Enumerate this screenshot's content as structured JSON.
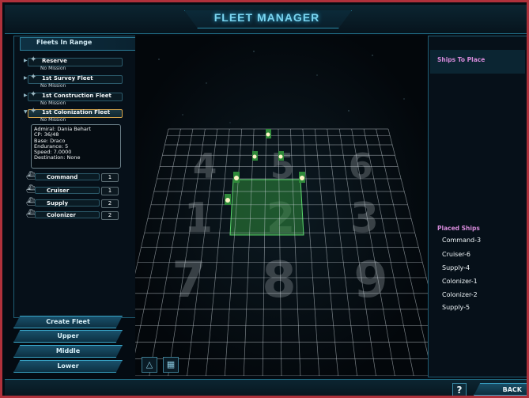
{
  "title": "FLEET MANAGER",
  "left": {
    "header": "Fleets In Range",
    "fleets": [
      {
        "name": "Reserve",
        "mission": "No Mission",
        "selected": false
      },
      {
        "name": "1st Survey Fleet",
        "mission": "No Mission",
        "selected": false
      },
      {
        "name": "1st Construction Fleet",
        "mission": "No Mission",
        "selected": false
      },
      {
        "name": "1st Colonization Fleet",
        "mission": "No Mission",
        "selected": true
      }
    ],
    "info": {
      "admiral": "Admiral: Dania Behart",
      "cp": "CP: 36/48",
      "base": "Base: Draco",
      "endurance": "Endurance: 5",
      "speed": "Speed: 7.0000",
      "destination": "Destination: None"
    },
    "ships": [
      {
        "name": "Command",
        "count": "1"
      },
      {
        "name": "Cruiser",
        "count": "1"
      },
      {
        "name": "Supply",
        "count": "2"
      },
      {
        "name": "Colonizer",
        "count": "2"
      }
    ],
    "buttons": [
      "Create Fleet",
      "Upper",
      "Middle",
      "Lower"
    ]
  },
  "grid": {
    "cell_numbers": [
      "4",
      "5",
      "6",
      "1",
      "2",
      "3",
      "7",
      "8",
      "9"
    ]
  },
  "right": {
    "ships_to_place_label": "Ships To Place",
    "placed_label": "Placed Ships",
    "placed": [
      "Command-3",
      "Cruiser-6",
      "Supply-4",
      "Colonizer-1",
      "Colonizer-2",
      "Supply-5"
    ]
  },
  "bottom": {
    "help": "?",
    "back": "BACK"
  },
  "colors": {
    "accent": "#3aa6c8",
    "highlight_cells": "#2f8a3a",
    "placed_label": "#d58ad9",
    "frame": "#b0313b"
  },
  "icons": {
    "formation": "triangle-formation-icon",
    "grid": "grid-view-icon",
    "fleet": "fleet-insignia-icon",
    "ship": "ship-icon"
  }
}
